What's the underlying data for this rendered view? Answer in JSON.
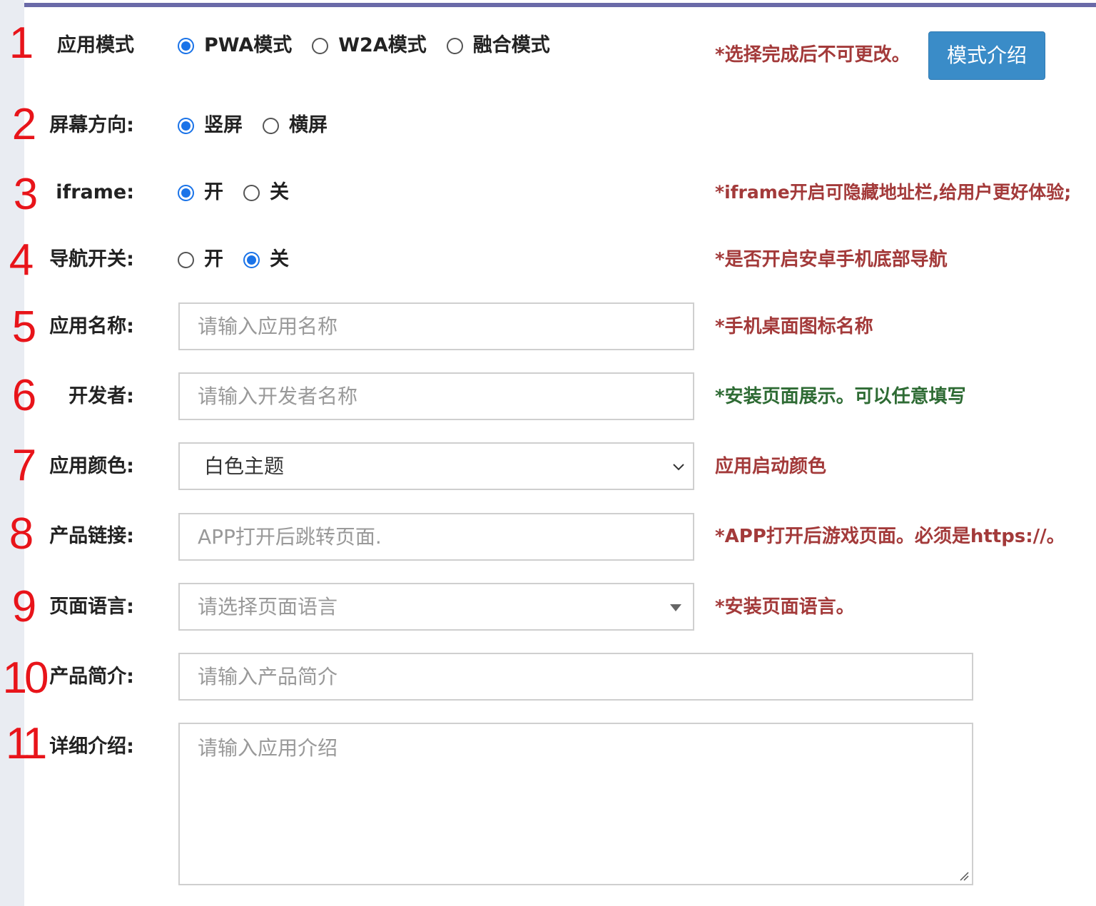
{
  "rows": {
    "mode": {
      "num": "1",
      "label": "应用模式",
      "options": [
        "PWA模式",
        "W2A模式",
        "融合模式"
      ],
      "selected": 0,
      "hint": "*选择完成后不可更改。",
      "button": "模式介绍"
    },
    "orientation": {
      "num": "2",
      "label": "屏幕方向:",
      "options": [
        "竖屏",
        "横屏"
      ],
      "selected": 0
    },
    "iframe": {
      "num": "3",
      "label": "iframe:",
      "options": [
        "开",
        "关"
      ],
      "selected": 0,
      "hint": "*iframe开启可隐藏地址栏,给用户更好体验;"
    },
    "nav": {
      "num": "4",
      "label": "导航开关:",
      "options": [
        "开",
        "关"
      ],
      "selected": 1,
      "hint": "*是否开启安卓手机底部导航"
    },
    "app_name": {
      "num": "5",
      "label": "应用名称:",
      "placeholder": "请输入应用名称",
      "hint": "*手机桌面图标名称"
    },
    "developer": {
      "num": "6",
      "label": "开发者:",
      "placeholder": "请输入开发者名称",
      "hint": "*安装页面展示。可以任意填写"
    },
    "color": {
      "num": "7",
      "label": "应用颜色:",
      "value": "白色主题",
      "hint": "应用启动颜色"
    },
    "link": {
      "num": "8",
      "label": "产品链接:",
      "placeholder": "APP打开后跳转页面.",
      "hint": "*APP打开后游戏页面。必须是https://。"
    },
    "language": {
      "num": "9",
      "label": "页面语言:",
      "placeholder": "请选择页面语言",
      "hint": "*安装页面语言。"
    },
    "summary": {
      "num": "10",
      "label": "产品简介:",
      "placeholder": "请输入产品简介"
    },
    "detail": {
      "num": "11",
      "label": "详细介绍:",
      "placeholder": "请输入应用介绍"
    }
  },
  "colors": {
    "accent": "#1a73e8",
    "hint_red": "#a33a3a",
    "hint_green": "#2e6b34",
    "number_red": "#e8141a",
    "button_blue": "#3a8cc8"
  },
  "icons": [
    "chevron-down-icon",
    "caret-down-icon",
    "resize-grip-icon"
  ]
}
